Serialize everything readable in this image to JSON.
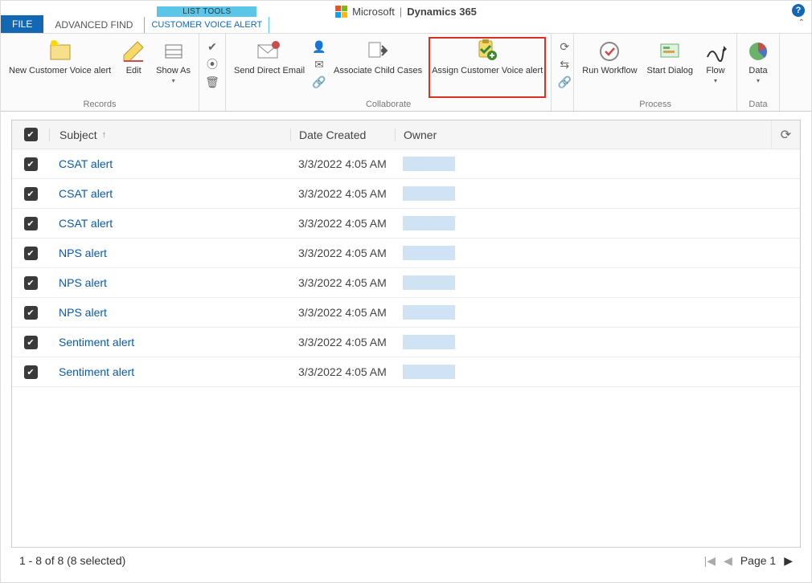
{
  "brand": {
    "ms": "Microsoft",
    "product": "Dynamics 365"
  },
  "tabs": {
    "file": "FILE",
    "advanced": "ADVANCED FIND",
    "contextualGroup": "LIST TOOLS",
    "contextualTab": "CUSTOMER VOICE ALERT"
  },
  "ribbon": {
    "records": {
      "label": "Records",
      "newAlert": "New Customer Voice alert",
      "edit": "Edit",
      "showAs": "Show As"
    },
    "delete": "",
    "collaborate": {
      "label": "Collaborate",
      "sendEmail": "Send Direct Email",
      "associate": "Associate Child Cases",
      "assign": "Assign Customer Voice alert"
    },
    "process": {
      "label": "Process",
      "workflow": "Run Workflow",
      "dialog": "Start Dialog",
      "flow": "Flow"
    },
    "data": {
      "label": "Data",
      "data": "Data"
    }
  },
  "grid": {
    "headers": {
      "subject": "Subject",
      "date": "Date Created",
      "owner": "Owner"
    },
    "rows": [
      {
        "subject": "CSAT alert",
        "date": "3/3/2022 4:05 AM"
      },
      {
        "subject": "CSAT alert",
        "date": "3/3/2022 4:05 AM"
      },
      {
        "subject": "CSAT alert",
        "date": "3/3/2022 4:05 AM"
      },
      {
        "subject": "NPS alert",
        "date": "3/3/2022 4:05 AM"
      },
      {
        "subject": "NPS alert",
        "date": "3/3/2022 4:05 AM"
      },
      {
        "subject": "NPS alert",
        "date": "3/3/2022 4:05 AM"
      },
      {
        "subject": "Sentiment alert",
        "date": "3/3/2022 4:05 AM"
      },
      {
        "subject": "Sentiment alert",
        "date": "3/3/2022 4:05 AM"
      }
    ]
  },
  "footer": {
    "status": "1 - 8 of 8 (8 selected)",
    "page": "Page 1"
  }
}
